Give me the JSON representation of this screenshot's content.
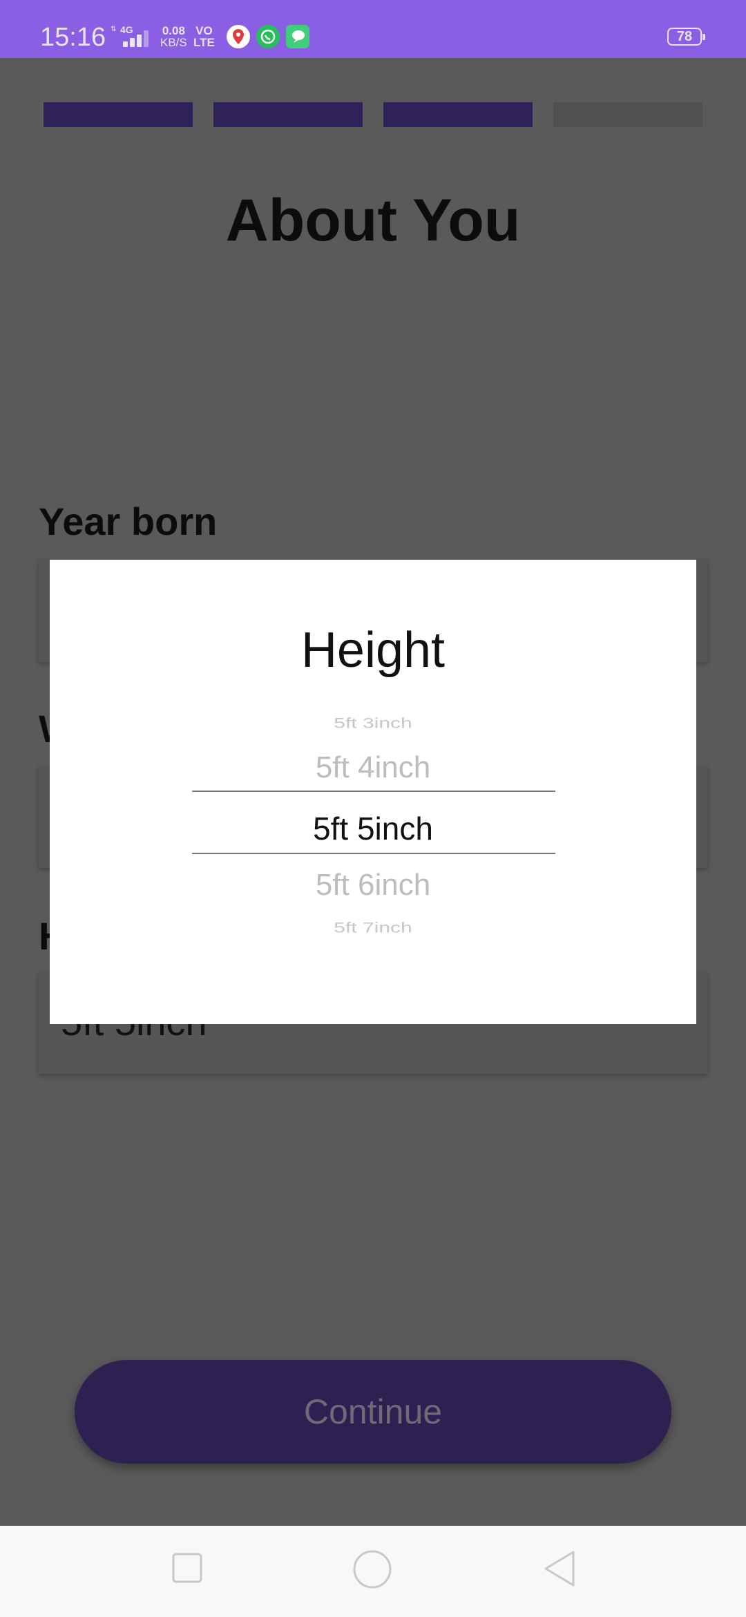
{
  "status_bar": {
    "time": "15:16",
    "network": "4G",
    "speed_value": "0.08",
    "speed_unit": "KB/S",
    "volte_top": "VO",
    "volte_bottom": "LTE",
    "battery": "78",
    "notification_icons": [
      "maps-pin-icon",
      "whatsapp-icon",
      "messenger-icon"
    ]
  },
  "progress": {
    "steps_total": 4,
    "steps_done": 3
  },
  "page": {
    "title": "About You",
    "fields": [
      {
        "label": "Year born",
        "value": ""
      },
      {
        "label": "W",
        "value": ""
      },
      {
        "label": "H",
        "value": "5ft 5inch"
      }
    ],
    "continue_label": "Continue"
  },
  "dialog": {
    "title": "Height",
    "options": [
      "5ft 3inch",
      "5ft 4inch",
      "5ft 5inch",
      "5ft 6inch",
      "5ft 7inch"
    ],
    "selected": "5ft 5inch"
  },
  "nav_bar": {
    "icons": [
      "recents-square-icon",
      "home-circle-icon",
      "back-triangle-icon"
    ]
  },
  "colors": {
    "status_bar": "#8a5fe3",
    "scrim_background": "#5a5a5a",
    "accent_dark": "#2f2052",
    "dialog": "#ffffff"
  }
}
